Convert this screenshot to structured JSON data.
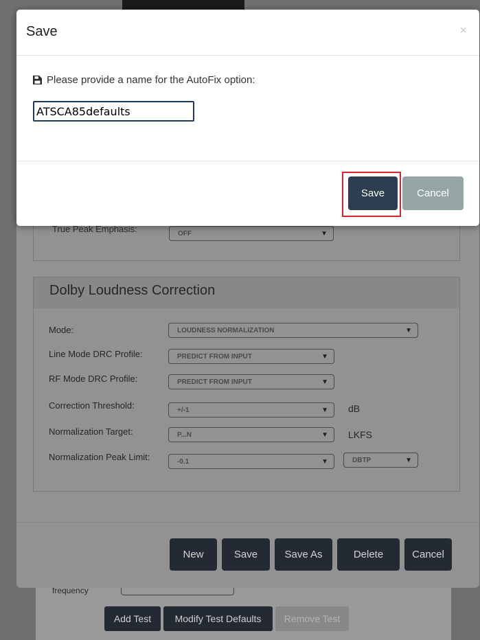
{
  "modal": {
    "title": "Save",
    "close_glyph": "×",
    "prompt": "Please provide a name for the AutoFix option:",
    "prompt_icon": "save-icon",
    "name_value": "ATSCA85defaults",
    "save_label": "Save",
    "cancel_label": "Cancel"
  },
  "background": {
    "true_peak_label": "True Peak Emphasis:",
    "true_peak_value": "OFF",
    "dolby": {
      "title": "Dolby Loudness Correction",
      "fields": [
        {
          "label": "Mode:",
          "value": "LOUDNESS NORMALIZATION",
          "unit": ""
        },
        {
          "label": "Line Mode DRC Profile:",
          "value": "PREDICT FROM INPUT",
          "unit": ""
        },
        {
          "label": "RF Mode DRC Profile:",
          "value": "PREDICT FROM INPUT",
          "unit": ""
        },
        {
          "label": "Correction Threshold:",
          "value": "+/-1",
          "unit": "dB"
        },
        {
          "label": "Normalization Target:",
          "value": "P...N",
          "unit": "LKFS"
        },
        {
          "label": "Normalization Peak Limit:",
          "value": "-0.1",
          "unit": "DBTP"
        }
      ]
    },
    "dialog_buttons": [
      "New",
      "Save",
      "Save As",
      "Delete",
      "Cancel"
    ],
    "frequency_label": "frequency",
    "page_buttons": [
      "Add Test",
      "Modify Test Defaults",
      "Remove Test"
    ]
  },
  "colors": {
    "primary_button": "#2c3e50",
    "secondary_button": "#95a5a6",
    "highlight": "#d9232d"
  }
}
